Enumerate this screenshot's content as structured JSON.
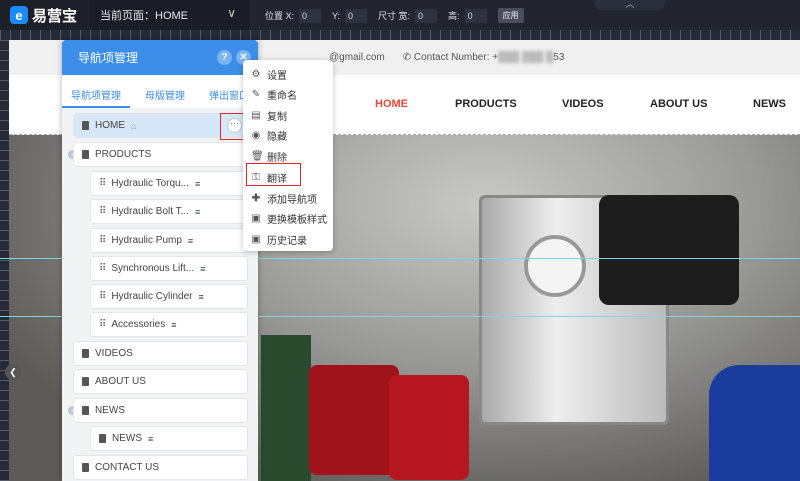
{
  "topbar": {
    "logo": "易营宝",
    "current_page": "当前页面：HOME",
    "pos_x_label": "位置 X:",
    "pos_x": "0",
    "pos_y_label": "Y:",
    "pos_y": "0",
    "size_w_label": "尺寸 宽:",
    "size_w": "0",
    "size_h_label": "高:",
    "size_h": "0",
    "apply": "应用"
  },
  "site": {
    "email": "@gmail.com",
    "contact": "Contact Number: +",
    "contact_tail": "53",
    "nav": [
      "HOME",
      "PRODUCTS",
      "VIDEOS",
      "ABOUT US",
      "NEWS"
    ]
  },
  "panel": {
    "title": "导航项管理",
    "help": "?",
    "close": "✕",
    "tabs": [
      "导航项管理",
      "母版管理",
      "弹出窗口"
    ],
    "items": [
      "HOME",
      "PRODUCTS",
      "VIDEOS",
      "ABOUT US",
      "NEWS",
      "CONTACT US"
    ],
    "products_children": [
      "Hydraulic Torqu...",
      "Hydraulic Bolt T...",
      "Hydraulic Pump",
      "Synchronous Lift...",
      "Hydraulic Cylinder",
      "Accessories"
    ],
    "news_children": [
      "NEWS"
    ]
  },
  "menu": [
    "设置",
    "重命名",
    "复制",
    "隐藏",
    "删除",
    "翻译",
    "添加导航项",
    "更换模板样式",
    "历史记录"
  ],
  "colors": {
    "accent": "#3d8ee8",
    "nav_active": "#e8483a",
    "highlight": "#e0262c"
  }
}
